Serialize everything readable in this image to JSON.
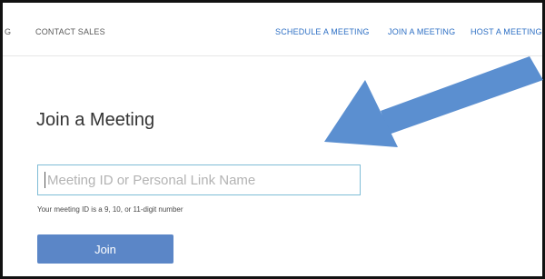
{
  "nav": {
    "left_cut": "G",
    "contact_sales": "CONTACT SALES",
    "schedule_meeting": "SCHEDULE A MEETING",
    "join_meeting": "JOIN A MEETING",
    "host_meeting": "HOST A MEETING",
    "host_caret": "▾"
  },
  "main": {
    "title": "Join a Meeting",
    "input_placeholder": "Meeting ID or Personal Link Name",
    "input_value": "",
    "hint": "Your meeting ID is a 9, 10, or 11-digit number",
    "join_label": "Join"
  },
  "colors": {
    "nav_link": "#2d6fc4",
    "button": "#5b86c7",
    "input_border": "#7fbdd6",
    "annotation_arrow": "#5b8fd0"
  }
}
